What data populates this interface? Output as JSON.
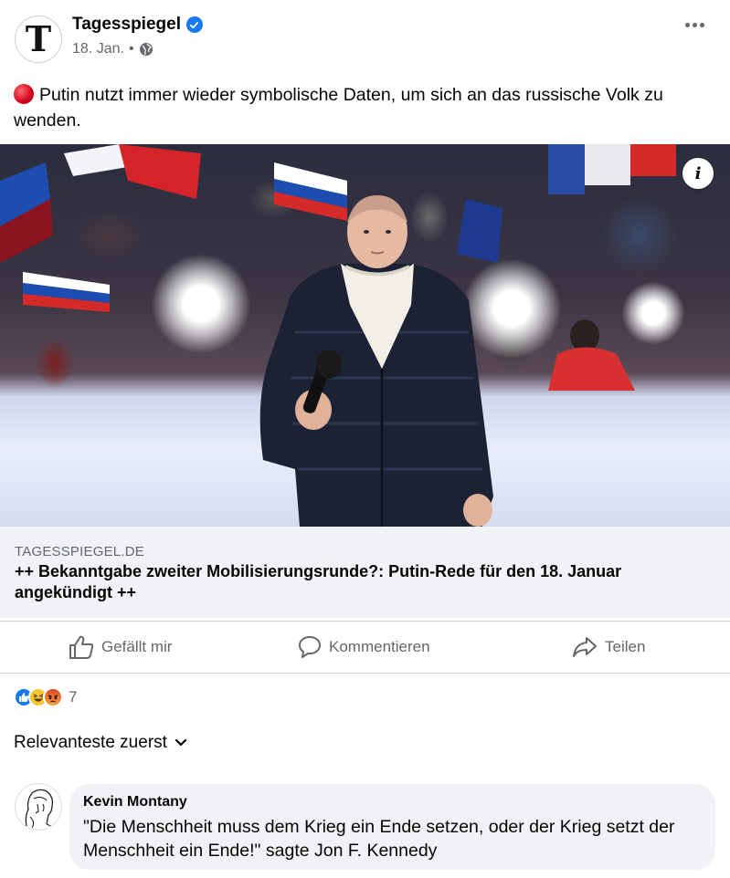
{
  "post": {
    "page_name": "Tagesspiegel",
    "avatar_letter": "T",
    "date": "18. Jan.",
    "separator": "•",
    "text": "Putin nutzt immer wieder symbolische Daten, um sich an das russische Volk zu wenden.",
    "icons": {
      "verified": "verified-badge-icon",
      "audience": "globe-icon",
      "more": "more-icon",
      "emoji": "red-circle-emoji"
    }
  },
  "link": {
    "domain": "TAGESSPIEGEL.DE",
    "title": "++ Bekanntgabe zweiter Mobilisierungsrunde?: Putin-Rede für den 18. Januar angekündigt ++",
    "info_symbol": "i"
  },
  "actions": {
    "like": "Gefällt mir",
    "comment": "Kommentieren",
    "share": "Teilen"
  },
  "reactions": {
    "types": [
      "like",
      "haha",
      "angry"
    ],
    "count": "7"
  },
  "comments": {
    "sort_label": "Relevanteste zuerst",
    "items": [
      {
        "author": "Kevin Montany",
        "text": "\"Die Menschheit muss dem Krieg ein Ende setzen, oder der Krieg setzt der Menschheit ein Ende!\" sagte Jon F. Kennedy"
      }
    ]
  },
  "colors": {
    "brand_blue": "#1877f2",
    "text_secondary": "#65676b",
    "link_bg": "#f0f2f5",
    "divider": "#ced0d4"
  }
}
